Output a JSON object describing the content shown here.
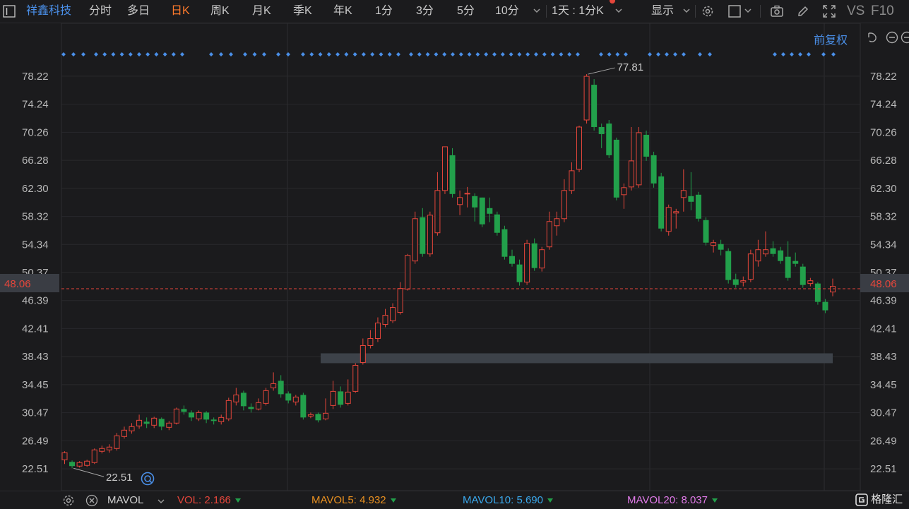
{
  "toolbar": {
    "stock_name": "祥鑫科技",
    "periods": [
      "分时",
      "多日",
      "日K",
      "周K",
      "月K",
      "季K",
      "年K",
      "1分",
      "3分",
      "5分",
      "10分"
    ],
    "active_period": "日K",
    "multi_frame": "1天 : 1分K",
    "display": "显示",
    "vs": "VS",
    "f10": "F10"
  },
  "adjust_label": "前复权",
  "chart_data": {
    "type": "candlestick",
    "y_ticks": [
      "78.22",
      "74.24",
      "70.26",
      "66.28",
      "62.30",
      "58.32",
      "54.34",
      "50.37",
      "46.39",
      "42.41",
      "38.43",
      "34.45",
      "30.47",
      "26.49",
      "22.51"
    ],
    "ylim": [
      20.52,
      80.21
    ],
    "current_price": "48.06",
    "max_label": "77.81",
    "min_label": "22.51",
    "candles": [
      [
        23.8,
        24.8,
        23.2,
        25.0
      ],
      [
        23.5,
        22.9,
        22.6,
        23.7
      ],
      [
        22.9,
        23.4,
        22.7,
        23.6
      ],
      [
        23.0,
        23.6,
        22.8,
        23.8
      ],
      [
        23.4,
        25.2,
        23.2,
        25.4
      ],
      [
        25.0,
        25.4,
        24.7,
        25.8
      ],
      [
        25.2,
        25.6,
        24.8,
        26.0
      ],
      [
        25.4,
        27.2,
        25.1,
        27.6
      ],
      [
        27.1,
        28.0,
        26.8,
        28.5
      ],
      [
        27.9,
        28.5,
        27.5,
        29.0
      ],
      [
        28.6,
        29.4,
        28.2,
        30.2
      ],
      [
        29.2,
        28.9,
        28.3,
        29.8
      ],
      [
        28.7,
        29.7,
        28.3,
        29.9
      ],
      [
        29.6,
        28.5,
        28.0,
        29.8
      ],
      [
        28.4,
        29.0,
        28.0,
        29.3
      ],
      [
        29.0,
        31.0,
        28.8,
        31.2
      ],
      [
        31.0,
        30.6,
        30.2,
        31.5
      ],
      [
        30.5,
        29.8,
        29.3,
        30.8
      ],
      [
        29.6,
        30.5,
        29.3,
        30.8
      ],
      [
        30.5,
        29.5,
        29.0,
        30.7
      ],
      [
        29.5,
        29.3,
        28.8,
        29.8
      ],
      [
        29.2,
        29.8,
        28.8,
        30.2
      ],
      [
        29.6,
        32.2,
        29.3,
        32.6
      ],
      [
        32.0,
        33.0,
        31.5,
        34.0
      ],
      [
        33.3,
        31.4,
        30.8,
        33.6
      ],
      [
        31.3,
        31.0,
        30.5,
        31.8
      ],
      [
        31.0,
        31.9,
        30.8,
        32.5
      ],
      [
        31.8,
        33.6,
        31.5,
        34.0
      ],
      [
        34.0,
        34.6,
        33.6,
        36.2
      ],
      [
        35.0,
        33.1,
        32.6,
        35.8
      ],
      [
        33.2,
        32.2,
        31.8,
        33.5
      ],
      [
        32.0,
        32.7,
        31.5,
        33.0
      ],
      [
        33.0,
        29.8,
        29.5,
        33.3
      ],
      [
        30.0,
        30.2,
        29.7,
        30.5
      ],
      [
        30.3,
        29.4,
        29.1,
        30.5
      ],
      [
        29.6,
        30.4,
        29.4,
        32.5
      ],
      [
        31.5,
        33.5,
        31.0,
        35.0
      ],
      [
        33.5,
        31.6,
        31.2,
        34.2
      ],
      [
        31.8,
        33.4,
        31.5,
        35.2
      ],
      [
        33.5,
        37.2,
        33.3,
        37.5
      ],
      [
        37.6,
        40.0,
        37.3,
        41.0
      ],
      [
        40.0,
        41.0,
        39.6,
        42.2
      ],
      [
        41.0,
        43.2,
        40.5,
        44.0
      ],
      [
        43.0,
        44.3,
        42.6,
        45.2
      ],
      [
        43.5,
        45.4,
        43.2,
        46.0
      ],
      [
        44.7,
        48.1,
        44.4,
        49.0
      ],
      [
        48.0,
        52.8,
        47.8,
        53.0
      ],
      [
        52.0,
        58.0,
        51.6,
        59.0
      ],
      [
        58.2,
        53.0,
        52.6,
        59.5
      ],
      [
        53.0,
        58.5,
        52.6,
        59.0
      ],
      [
        56.0,
        62.0,
        55.6,
        64.6
      ],
      [
        62.0,
        68.2,
        61.5,
        68.2
      ],
      [
        67.0,
        61.5,
        61.0,
        68.0
      ],
      [
        60.0,
        61.0,
        58.5,
        62.0
      ],
      [
        61.5,
        61.6,
        59.6,
        62.5
      ],
      [
        61.2,
        59.6,
        57.6,
        61.6
      ],
      [
        61.0,
        57.2,
        56.8,
        61.0
      ],
      [
        59.5,
        58.7,
        57.5,
        61.0
      ],
      [
        58.6,
        56.0,
        55.6,
        59.0
      ],
      [
        56.5,
        52.6,
        52.2,
        57.0
      ],
      [
        52.7,
        51.6,
        51.2,
        53.6
      ],
      [
        51.5,
        49.0,
        48.5,
        52.2
      ],
      [
        49.0,
        54.5,
        48.6,
        55.0
      ],
      [
        54.5,
        51.0,
        50.6,
        55.2
      ],
      [
        51.0,
        53.6,
        50.5,
        54.0
      ],
      [
        54.0,
        57.6,
        53.6,
        59.0
      ],
      [
        57.0,
        58.0,
        55.6,
        59.0
      ],
      [
        58.0,
        62.0,
        57.5,
        63.6
      ],
      [
        62.0,
        64.8,
        61.5,
        66.0
      ],
      [
        65.0,
        71.0,
        64.6,
        71.2
      ],
      [
        72.0,
        78.2,
        71.5,
        78.5
      ],
      [
        77.0,
        71.0,
        70.5,
        77.8
      ],
      [
        71.0,
        70.0,
        68.0,
        71.5
      ],
      [
        71.5,
        67.0,
        66.6,
        72.0
      ],
      [
        69.2,
        61.0,
        60.6,
        69.5
      ],
      [
        61.4,
        62.4,
        59.4,
        63.0
      ],
      [
        62.5,
        66.2,
        62.0,
        71.0
      ],
      [
        62.8,
        70.2,
        62.4,
        71.0
      ],
      [
        69.9,
        66.8,
        66.2,
        70.5
      ],
      [
        67.0,
        63.0,
        62.4,
        67.5
      ],
      [
        64.0,
        56.6,
        56.2,
        64.5
      ],
      [
        56.2,
        59.6,
        55.6,
        60.0
      ],
      [
        58.8,
        59.0,
        56.6,
        59.4
      ],
      [
        61.0,
        62.0,
        59.0,
        65.0
      ],
      [
        61.2,
        60.4,
        59.2,
        64.6
      ],
      [
        61.4,
        58.0,
        57.6,
        61.8
      ],
      [
        57.8,
        54.6,
        54.2,
        58.2
      ],
      [
        54.2,
        54.6,
        53.2,
        55.0
      ],
      [
        54.4,
        53.6,
        52.8,
        55.0
      ],
      [
        53.4,
        49.3,
        48.8,
        53.8
      ],
      [
        49.4,
        48.6,
        48.2,
        50.2
      ],
      [
        49.0,
        49.2,
        48.4,
        49.8
      ],
      [
        49.4,
        53.0,
        49.0,
        53.6
      ],
      [
        52.0,
        53.6,
        51.2,
        55.0
      ],
      [
        53.0,
        53.6,
        52.6,
        56.2
      ],
      [
        53.8,
        53.0,
        52.6,
        54.8
      ],
      [
        53.5,
        52.0,
        51.6,
        54.0
      ],
      [
        52.6,
        49.6,
        49.2,
        54.8
      ],
      [
        52.0,
        51.6,
        51.2,
        53.2
      ],
      [
        51.2,
        48.6,
        48.2,
        51.6
      ],
      [
        48.8,
        49.2,
        48.4,
        49.6
      ],
      [
        48.8,
        46.2,
        45.8,
        49.0
      ],
      [
        46.2,
        45.0,
        44.6,
        46.6
      ],
      [
        47.6,
        48.4,
        47.0,
        49.5
      ]
    ],
    "support_band": [
      37.5,
      38.9
    ],
    "marker_groups": [
      [
        90,
        118,
        3
      ],
      [
        136,
        258,
        11
      ],
      [
        299,
        327,
        3
      ],
      [
        347,
        374,
        3
      ],
      [
        394,
        408,
        2
      ],
      [
        429,
        564,
        12
      ],
      [
        582,
        818,
        21
      ],
      [
        851,
        886,
        4
      ],
      [
        920,
        968,
        5
      ],
      [
        991,
        1005,
        2
      ],
      [
        1097,
        1145,
        5
      ],
      [
        1166,
        1180,
        2
      ]
    ]
  },
  "status": {
    "indicator": "MAVOL",
    "vol_label": "VOL:",
    "vol_value": "2.166",
    "mavol5_label": "MAVOL5:",
    "mavol5_value": "4.932",
    "mavol10_label": "MAVOL10:",
    "mavol10_value": "5.690",
    "mavol20_label": "MAVOL20:",
    "mavol20_value": "8.037",
    "brand": "格隆汇"
  },
  "colors": {
    "up": "#e5463b",
    "down": "#22a04b",
    "accent_blue": "#4a8fe8",
    "active_orange": "#ff7a2b",
    "mavol5": "#e89020",
    "mavol10": "#3aa8ec",
    "mavol20": "#e07ae8"
  }
}
